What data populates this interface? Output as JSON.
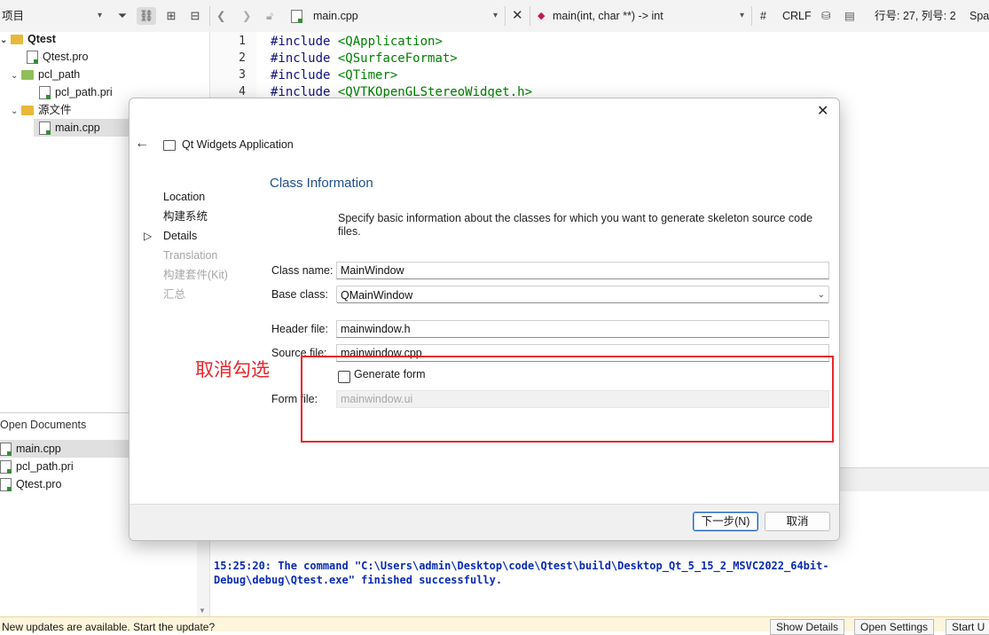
{
  "toolbar": {
    "project_label": "项目",
    "filter_icon": "filter-icon",
    "link_icon": "link-icon",
    "file_name": "main.cpp",
    "function_signature": "main(int, char **) -> int",
    "hash": "#",
    "line_ending": "CRLF",
    "cursor_position": "行号: 27, 列号: 2",
    "spaces_label": "Spa"
  },
  "project_tree": [
    {
      "label": "Qtest",
      "type": "project"
    },
    {
      "label": "Qtest.pro",
      "type": "file"
    },
    {
      "label": "pcl_path",
      "type": "folder"
    },
    {
      "label": "pcl_path.pri",
      "type": "file"
    },
    {
      "label": "源文件",
      "type": "folder"
    },
    {
      "label": "main.cpp",
      "type": "file"
    }
  ],
  "open_documents": {
    "title": "Open Documents",
    "items": [
      "main.cpp",
      "pcl_path.pri",
      "Qtest.pro"
    ]
  },
  "editor": {
    "lines": [
      {
        "num": "1",
        "kw": "#include",
        "str": "<QApplication>"
      },
      {
        "num": "2",
        "kw": "#include",
        "str": "<QSurfaceFormat>"
      },
      {
        "num": "3",
        "kw": "#include",
        "str": "<QTimer>"
      },
      {
        "num": "4",
        "kw": "#include",
        "str": "<QVTKOpenGLStereoWidget.h>"
      }
    ]
  },
  "output": {
    "text": "15:25:20: The command \"C:\\Users\\admin\\Desktop\\code\\Qtest\\build\\Desktop_Qt_5_15_2_MSVC2022_64bit-\nDebug\\debug\\Qtest.exe\" finished successfully."
  },
  "statusbar": {
    "message": "New updates are available. Start the update?",
    "show_details": "Show Details",
    "open_settings": "Open Settings",
    "start_update": "Start U"
  },
  "dialog": {
    "wizard_title": "Qt Widgets Application",
    "page_title": "Class Information",
    "steps": [
      {
        "label": "Location",
        "state": "done"
      },
      {
        "label": "构建系统",
        "state": "done"
      },
      {
        "label": "Details",
        "state": "current"
      },
      {
        "label": "Translation",
        "state": "pending"
      },
      {
        "label": "构建套件(Kit)",
        "state": "pending"
      },
      {
        "label": "汇总",
        "state": "pending"
      }
    ],
    "description": "Specify basic information about the classes for which you want to generate skeleton source code files.",
    "class_name_label": "Class name:",
    "class_name_value": "MainWindow",
    "base_class_label": "Base class:",
    "base_class_value": "QMainWindow",
    "header_file_label": "Header file:",
    "header_file_value": "mainwindow.h",
    "source_file_label": "Source file:",
    "source_file_value": "mainwindow.cpp",
    "generate_form_label": "Generate form",
    "generate_form_checked": false,
    "form_file_label": "Form file:",
    "form_file_value": "mainwindow.ui",
    "next_button": "下一步(N)",
    "cancel_button": "取消"
  },
  "annotation": {
    "text": "取消勾选",
    "color": "#e8262a"
  }
}
